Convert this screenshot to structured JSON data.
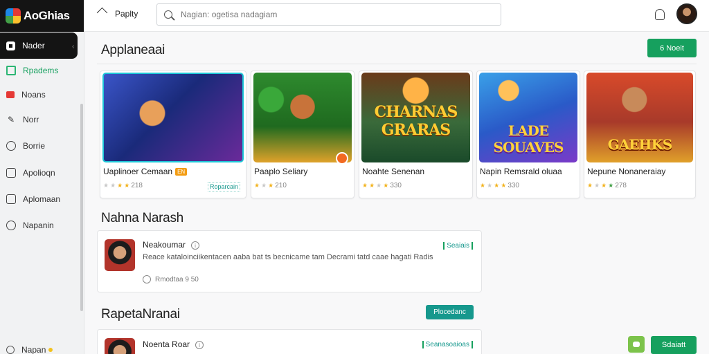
{
  "app": {
    "title": "AoGhias"
  },
  "sidebar": {
    "items": [
      {
        "label": "Nader",
        "icon": "store-icon",
        "active": true
      },
      {
        "label": "Rpadems",
        "icon": "games-icon"
      },
      {
        "label": "Noans",
        "icon": "movies-icon"
      },
      {
        "label": "Norr",
        "icon": "books-icon"
      },
      {
        "label": "Borrie",
        "icon": "user-icon"
      },
      {
        "label": "Apolioqn",
        "icon": "apps-icon"
      },
      {
        "label": "Aplomaan",
        "icon": "library-icon"
      },
      {
        "label": "Napanin",
        "icon": "kids-icon"
      }
    ],
    "profile_label": "Napan"
  },
  "topbar": {
    "home_label": "Paplty",
    "search_placeholder": "Nagian: ogetisa nadagiam"
  },
  "section1": {
    "title": "Applaneaai",
    "button": "6 Noeit",
    "games": [
      {
        "title": "Uaplinoer Cemaan",
        "tag": "EN",
        "rating": "218",
        "stars": 2,
        "badge": "Roparcain",
        "art_text": ""
      },
      {
        "title": "Paaplo Seliary",
        "rating": "210",
        "stars": 2,
        "art_text": ""
      },
      {
        "title": "Noahte Senenan",
        "rating": "330",
        "stars": 3,
        "art_text": "CHARNAS GRARAS"
      },
      {
        "title": "Napin Remsrald oluaa",
        "rating": "330",
        "stars": 3,
        "art_text": "LADE SOUAVES"
      },
      {
        "title": "Nepune Nonaneraiay",
        "rating": "278",
        "stars": 4,
        "art_text": "GAEHKS"
      }
    ]
  },
  "section2": {
    "title": "Nahna Narash",
    "item": {
      "name": "Neakoumar",
      "description": "Reace kataloinciikentacen aaba bat ts becnicame tam Decrami tatd caae hagati Radis",
      "meta": "Rmodtaa 9 50",
      "badge": "Seaiais"
    }
  },
  "section3": {
    "title": "RapetaNranai",
    "button": "Plocedanc",
    "item": {
      "name": "Noenta Roar",
      "badge": "Seanasoaioas"
    }
  },
  "floating": {
    "button": "Sdaiatt"
  },
  "colors": {
    "accent_green": "#16a05e",
    "accent_teal": "#16988d",
    "star": "#f2b21c"
  }
}
